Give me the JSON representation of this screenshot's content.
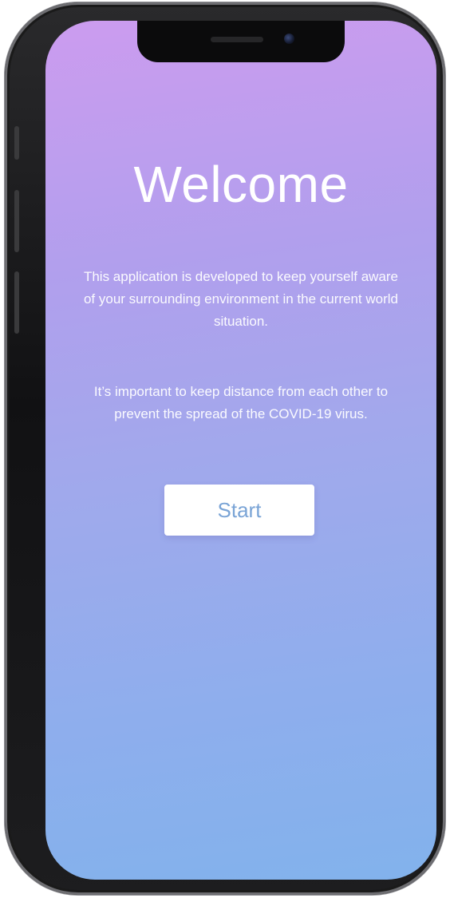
{
  "welcome": {
    "title": "Welcome",
    "description_1": "This application is developed to keep yourself aware of your surrounding environment in the current world situation.",
    "description_2": "It’s important to keep distance from each other to prevent the spread of the COVID-19 virus.",
    "start_label": "Start"
  },
  "colors": {
    "gradient_top": "#cc9cef",
    "gradient_bottom": "#82b2ec",
    "button_text": "#7aa4d6",
    "text": "#ffffff"
  }
}
